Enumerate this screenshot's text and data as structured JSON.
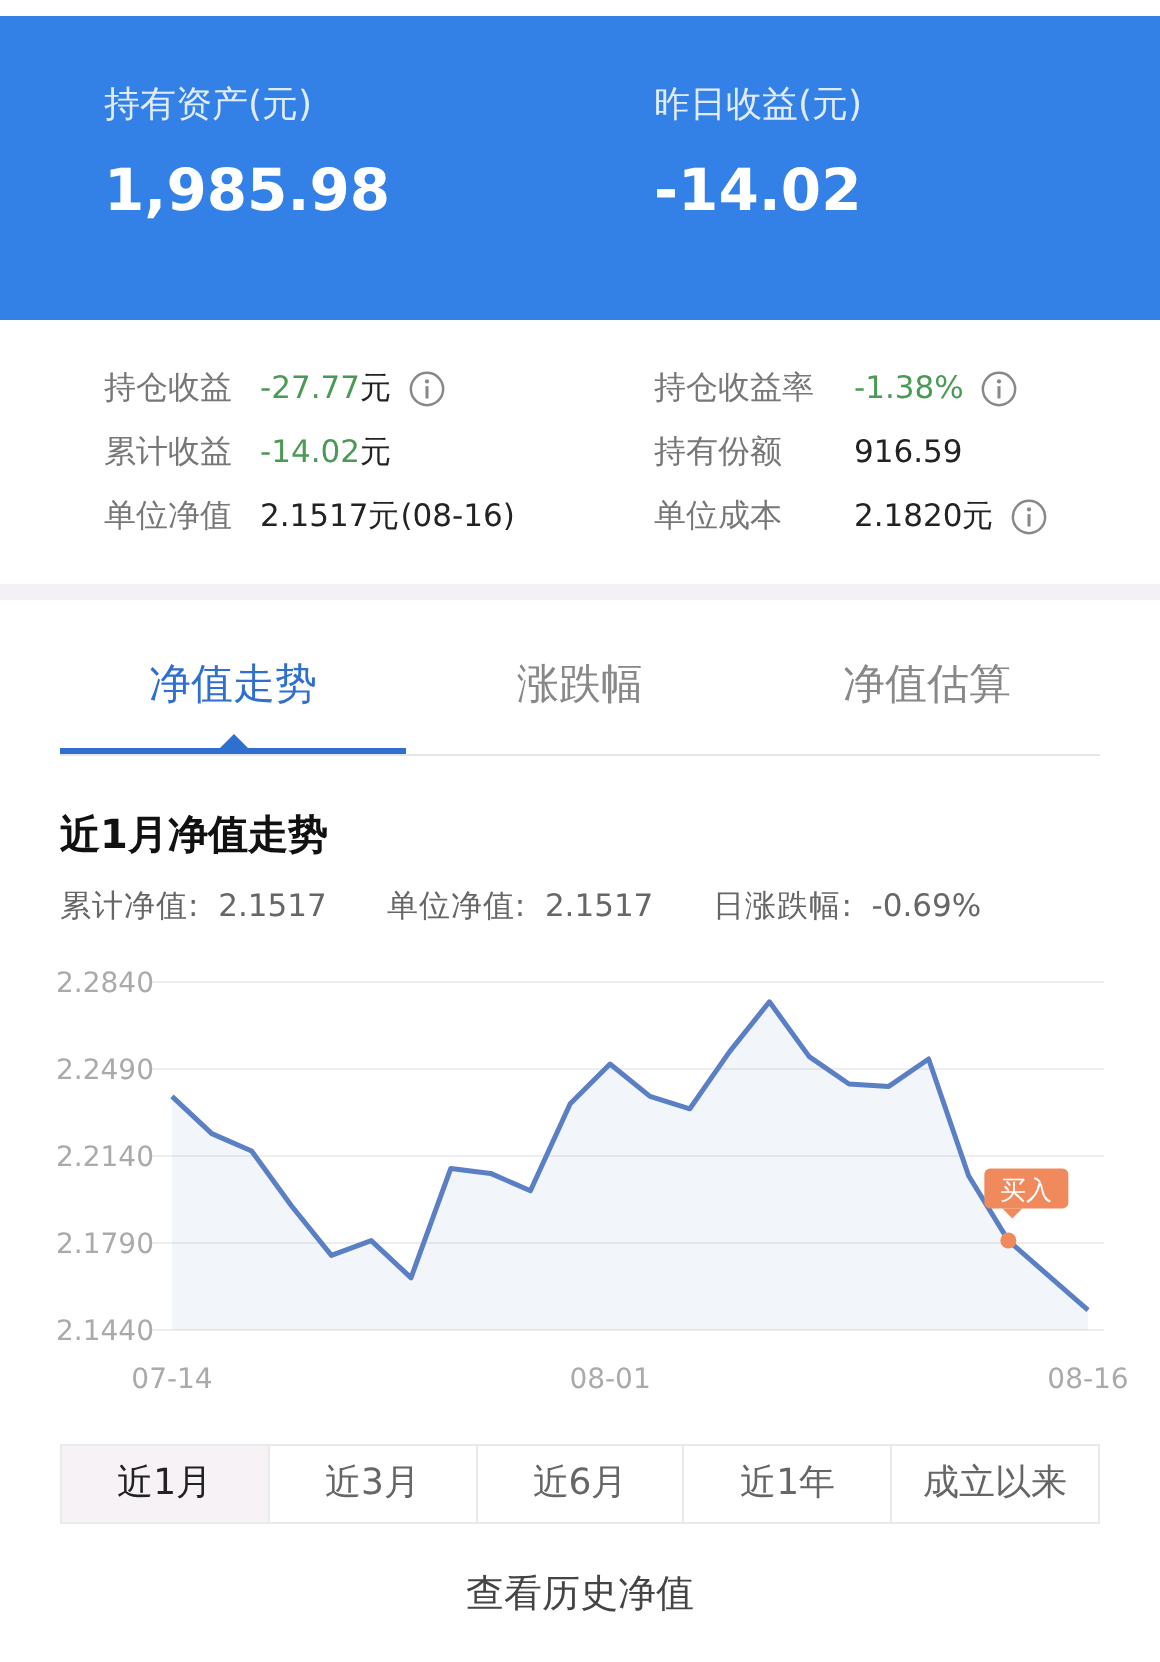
{
  "summary": [
    {
      "label": "持有资产(元)",
      "value": "1,985.98"
    },
    {
      "label": "昨日收益(元)",
      "value": "-14.02"
    }
  ],
  "details": [
    {
      "label": "持仓收益",
      "value": "-27.77",
      "unit": "元",
      "negative": true,
      "info": true
    },
    {
      "label": "持仓收益率",
      "value": "-1.38%",
      "negative": true,
      "info": true
    },
    {
      "label": "累计收益",
      "value": "-14.02",
      "unit": "元",
      "negative": true,
      "info": false
    },
    {
      "label": "持有份额",
      "value": "916.59",
      "negative": false,
      "info": false
    },
    {
      "label": "单位净值",
      "value": "2.1517元(08-16)",
      "negative": false,
      "info": false
    },
    {
      "label": "单位成本",
      "value": "2.1820元",
      "negative": false,
      "info": true
    }
  ],
  "tabs": [
    {
      "label": "净值走势",
      "selected": true
    },
    {
      "label": "涨跌幅",
      "selected": false
    },
    {
      "label": "净值估算",
      "selected": false
    }
  ],
  "section_title": "近1月净值走势",
  "stats": [
    {
      "label": "累计净值:",
      "value": "2.1517"
    },
    {
      "label": "单位净值:",
      "value": "2.1517"
    },
    {
      "label": "日涨跌幅:",
      "value": "-0.69%"
    }
  ],
  "chart_data": {
    "type": "area",
    "categories": [
      "07-14",
      null,
      null,
      null,
      null,
      null,
      null,
      null,
      null,
      null,
      null,
      "08-01",
      null,
      null,
      null,
      null,
      null,
      null,
      null,
      null,
      null,
      null,
      null,
      "08-16"
    ],
    "series": [
      {
        "color": "#5b7fc4",
        "values": [
          2.238,
          2.223,
          2.216,
          2.194,
          2.174,
          2.18,
          2.165,
          2.209,
          2.207,
          2.2,
          2.235,
          2.251,
          2.238,
          2.233,
          2.256,
          2.276,
          2.254,
          2.243,
          2.242,
          2.253,
          2.206,
          2.18,
          2.166,
          2.152
        ]
      }
    ],
    "ylim": [
      2.144,
      2.284
    ],
    "yticks": [
      {
        "value": 2.284,
        "label": "2.2840"
      },
      {
        "value": 2.249,
        "label": "2.2490"
      },
      {
        "value": 2.214,
        "label": "2.2140"
      },
      {
        "value": 2.179,
        "label": "2.1790"
      },
      {
        "value": 2.144,
        "label": "2.1440"
      }
    ],
    "grid": true,
    "annotations": [
      {
        "y": 2.18,
        "text": "买入"
      }
    ]
  },
  "periods": [
    {
      "label": "近1月",
      "selected": true
    },
    {
      "label": "近3月",
      "selected": false
    },
    {
      "label": "近6月",
      "selected": false
    },
    {
      "label": "近1年",
      "selected": false
    },
    {
      "label": "成立以来",
      "selected": false
    }
  ],
  "history_link": "查看历史净值"
}
